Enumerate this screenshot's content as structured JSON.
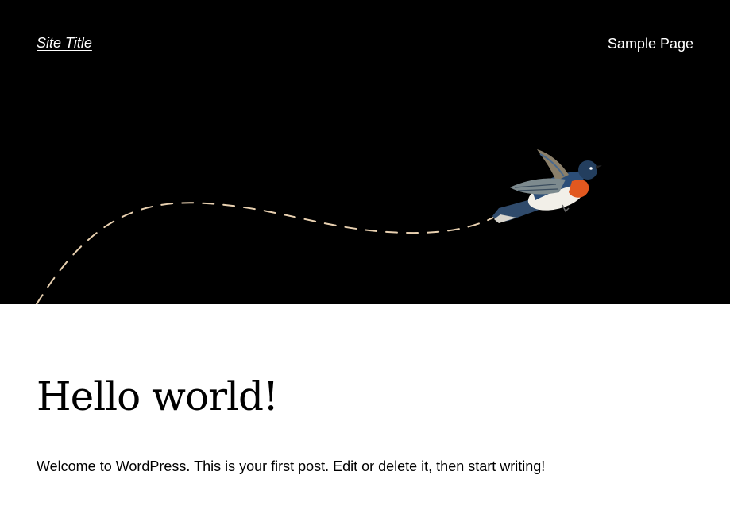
{
  "header": {
    "site_title": "Site Title",
    "nav": {
      "sample_page_label": "Sample Page"
    },
    "background_color": "#000000"
  },
  "hero": {
    "image": "bird-flight-illustration",
    "path_color": "#e8d0b0"
  },
  "post": {
    "title": "Hello world!",
    "excerpt": "Welcome to WordPress. This is your first post. Edit or delete it, then start writing!"
  }
}
